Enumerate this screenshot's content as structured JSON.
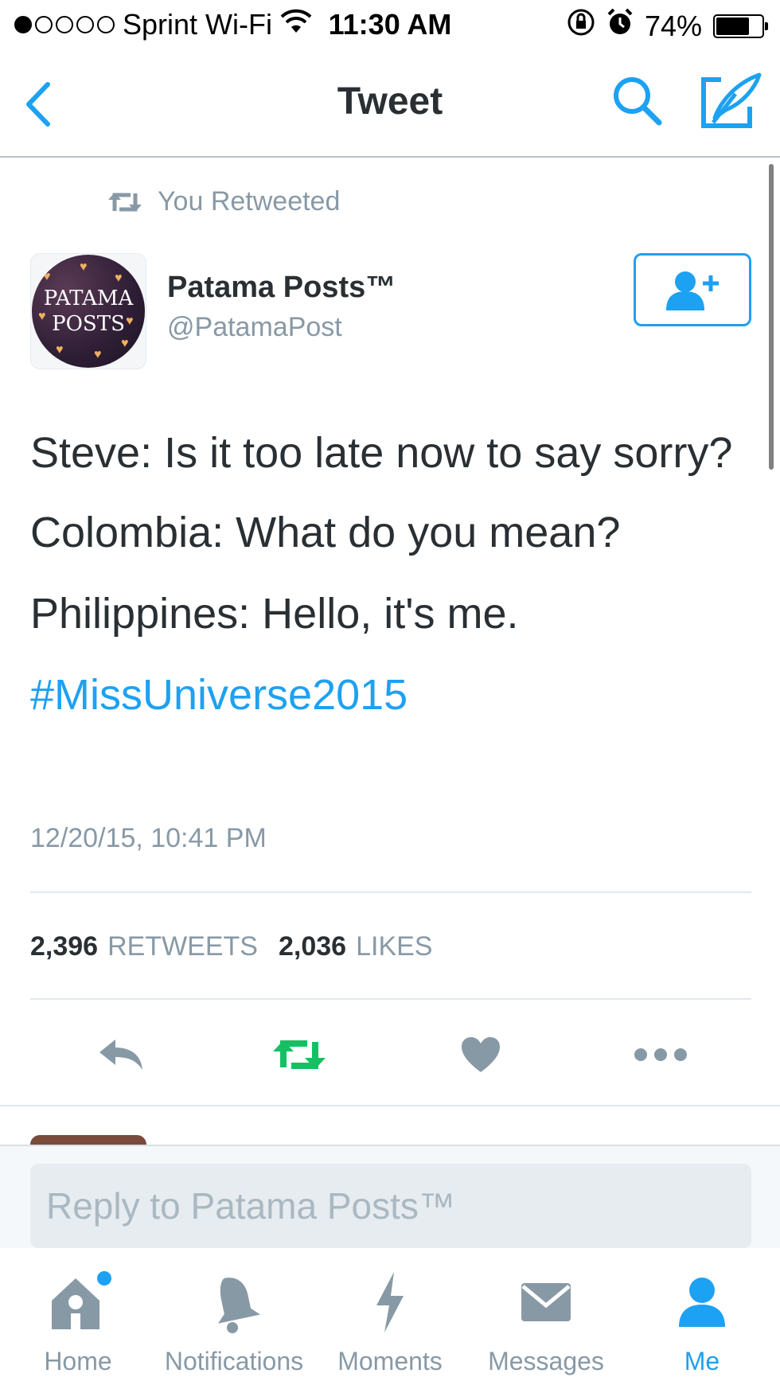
{
  "status_bar": {
    "signal_dots": [
      true,
      false,
      false,
      false,
      false
    ],
    "carrier": "Sprint Wi-Fi",
    "wifi_icon": "wifi-icon",
    "time": "11:30 AM",
    "battery_percent": "74%",
    "battery_level": 0.74
  },
  "nav": {
    "title": "Tweet",
    "back_icon": "chevron-left-icon",
    "search_icon": "search-icon",
    "compose_icon": "compose-icon"
  },
  "retweet_label": "You Retweeted",
  "author": {
    "name": "Patama Posts™",
    "handle": "@PatamaPost",
    "avatar_text_line1": "PATAMA",
    "avatar_text_line2": "POSTS"
  },
  "tweet": {
    "line1": "Steve: Is it too late now to say sorry?",
    "line2": "Colombia: What do you mean?",
    "line3": "Philippines: Hello, it's me.",
    "hashtag": "#MissUniverse2015",
    "timestamp": "12/20/15, 10:41 PM"
  },
  "stats": {
    "retweets_count": "2,396",
    "retweets_label": "RETWEETS",
    "likes_count": "2,036",
    "likes_label": "LIKES"
  },
  "colors": {
    "accent": "#1da1f2",
    "retweet_active": "#17bf63",
    "muted": "#8899a6"
  },
  "reply": {
    "placeholder": "Reply to Patama Posts™"
  },
  "tabs": [
    {
      "label": "Home",
      "icon": "home-icon",
      "active": false
    },
    {
      "label": "Notifications",
      "icon": "bell-icon",
      "active": false
    },
    {
      "label": "Moments",
      "icon": "lightning-icon",
      "active": false
    },
    {
      "label": "Messages",
      "icon": "envelope-icon",
      "active": false
    },
    {
      "label": "Me",
      "icon": "person-icon",
      "active": true
    }
  ]
}
